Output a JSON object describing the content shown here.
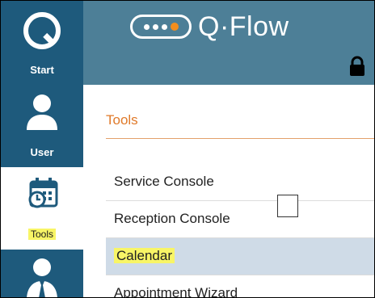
{
  "app": {
    "brand_name": "Q·Flow"
  },
  "nav": {
    "items": [
      {
        "label": "Start",
        "icon": "q-logo-icon"
      },
      {
        "label": "User",
        "icon": "user-icon"
      },
      {
        "label": "Tools",
        "icon": "calendar-icon",
        "selected": true
      },
      {
        "label": "",
        "icon": "user-tie-icon"
      }
    ]
  },
  "content": {
    "section_title": "Tools",
    "menu": [
      {
        "label": "Service Console"
      },
      {
        "label": "Reception Console"
      },
      {
        "label": "Calendar",
        "selected": true
      },
      {
        "label": "Appointment Wizard"
      }
    ]
  },
  "colors": {
    "nav_bg": "#1e5a7c",
    "header_bg": "#4d7f97",
    "accent_orange": "#f28e1e",
    "section_title": "#e07a2a",
    "selected_row": "#cfdbe7",
    "highlighter": "#f8f566"
  }
}
